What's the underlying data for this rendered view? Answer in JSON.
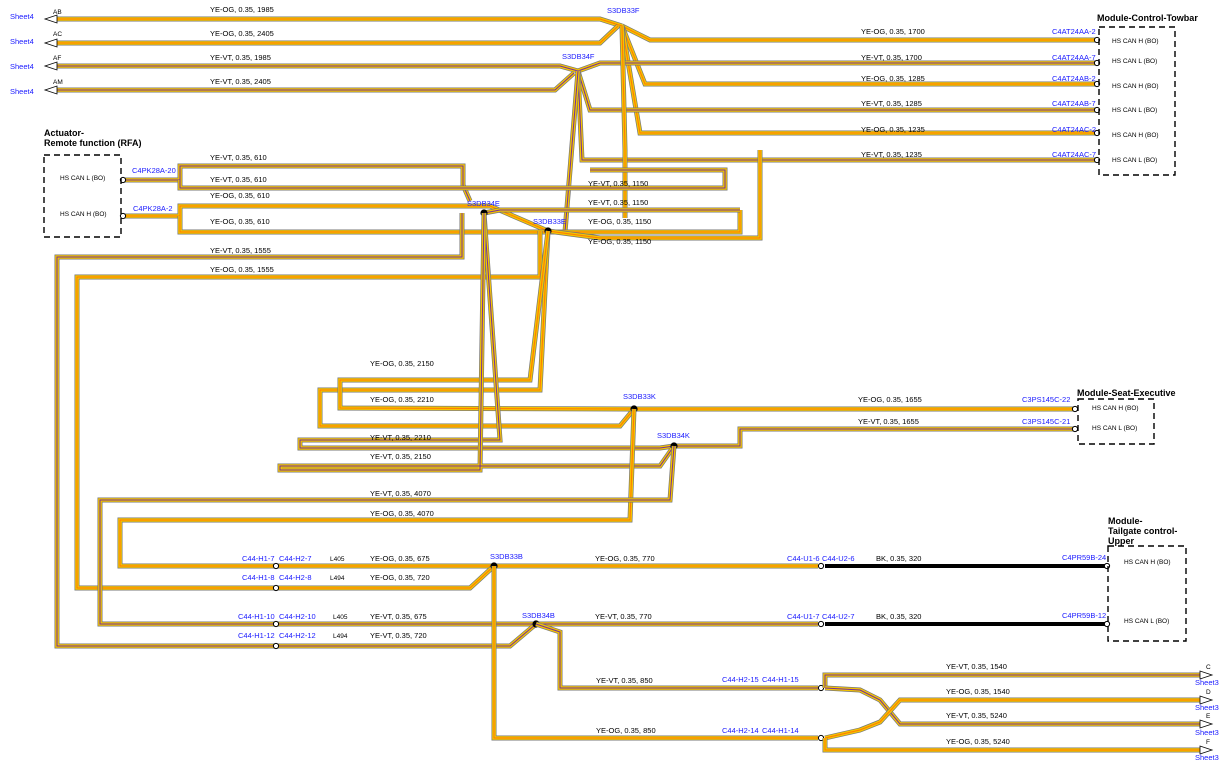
{
  "sheet_refs": [
    {
      "sheet": "Sheet4",
      "pin": "AB"
    },
    {
      "sheet": "Sheet4",
      "pin": "AC"
    },
    {
      "sheet": "Sheet4",
      "pin": "AF"
    },
    {
      "sheet": "Sheet4",
      "pin": "AM"
    },
    {
      "sheet": "Sheet3",
      "pin": "C"
    },
    {
      "sheet": "Sheet3",
      "pin": "D"
    },
    {
      "sheet": "Sheet3",
      "pin": "E"
    },
    {
      "sheet": "Sheet3",
      "pin": "F"
    }
  ],
  "modules": {
    "towbar": {
      "title": "Module-Control-Towbar",
      "pins": [
        "HS CAN H (BO)",
        "HS CAN L (BO)",
        "HS CAN H (BO)",
        "HS CAN L (BO)",
        "HS CAN H (BO)",
        "HS CAN L (BO)"
      ],
      "connectors": [
        "C4AT24AA-2",
        "C4AT24AA-7",
        "C4AT24AB-2",
        "C4AT24AB-7",
        "C4AT24AC-2",
        "C4AT24AC-7"
      ]
    },
    "actuator": {
      "title_line1": "Actuator-",
      "title_line2": "Remote function (RFA)",
      "pins": [
        "HS CAN L (BO)",
        "HS CAN H (BO)"
      ],
      "connectors": [
        "C4PK28A-20",
        "C4PK28A-2"
      ]
    },
    "seat": {
      "title": "Module-Seat-Executive",
      "pins": [
        "HS CAN H (BO)",
        "HS CAN L (BO)"
      ],
      "connectors": [
        "C3PS145C-22",
        "C3PS145C-21"
      ]
    },
    "tailgate": {
      "title_line1": "Module-",
      "title_line2": "Tailgate control-",
      "title_line3": "Upper",
      "pins": [
        "HS CAN H (BO)",
        "HS CAN L (BO)"
      ],
      "connectors": [
        "C4PR59B-24",
        "C4PR59B-12"
      ]
    }
  },
  "splices": [
    "S3DB33F",
    "S3DB34F",
    "S3DB34E",
    "S3DB33E",
    "S3DB33K",
    "S3DB34K",
    "S3DB33B",
    "S3DB34B"
  ],
  "inline_connectors": {
    "h1_7": "C44-H1-7",
    "h2_7": "C44-H2-7",
    "h1_8": "C44-H1-8",
    "h2_8": "C44-H2-8",
    "h1_10": "C44-H1-10",
    "h2_10": "C44-H2-10",
    "h1_12": "C44-H1-12",
    "h2_12": "C44-H2-12",
    "u1_6": "C44-U1-6",
    "u2_6": "C44-U2-6",
    "u1_7": "C44-U1-7",
    "u2_7": "C44-U2-7",
    "h2_15": "C44-H2-15",
    "h1_15": "C44-H1-15",
    "h2_14": "C44-H2-14",
    "h1_14": "C44-H1-14"
  },
  "circuits": {
    "l405a": "L405",
    "l494a": "L494",
    "l405b": "L405",
    "l494b": "L494"
  },
  "wire_labels": [
    "YE-OG,  0.35,  1985",
    "YE-OG,  0.35,  2405",
    "YE-VT,  0.35,  1985",
    "YE-VT,  0.35,  2405",
    "YE-OG,  0.35,  1700",
    "YE-VT,  0.35,  1700",
    "YE-OG,  0.35,  1285",
    "YE-VT,  0.35,  1285",
    "YE-OG,  0.35,  1235",
    "YE-VT,  0.35,  1235",
    "YE-VT,  0.35,  610",
    "YE-VT,  0.35,  610",
    "YE-OG,  0.35,  610",
    "YE-OG,  0.35,  610",
    "YE-VT,  0.35,  1150",
    "YE-VT,  0.35,  1150",
    "YE-OG,  0.35,  1150",
    "YE-OG,  0.35,  1150",
    "YE-VT,  0.35,  1555",
    "YE-OG,  0.35,  1555",
    "YE-OG,  0.35,  2150",
    "YE-OG,  0.35,  2210",
    "YE-VT,  0.35,  2210",
    "YE-VT,  0.35,  2150",
    "YE-OG,  0.35,  1655",
    "YE-VT,  0.35,  1655",
    "YE-VT,  0.35,  4070",
    "YE-OG,  0.35,  4070",
    "YE-OG,  0.35,  675",
    "YE-OG,  0.35,  720",
    "YE-OG,  0.35,  770",
    "BK,  0.35,  320",
    "YE-VT,  0.35,  675",
    "YE-VT,  0.35,  720",
    "YE-VT,  0.35,  770",
    "BK,  0.35,  320",
    "YE-VT,  0.35,  850",
    "YE-OG,  0.35,  850",
    "YE-VT,  0.35,  1540",
    "YE-OG,  0.35,  1540",
    "YE-VT,  0.35,  5240",
    "YE-OG,  0.35,  5240"
  ],
  "colors": {
    "yellow": "#f5c400",
    "orange": "#ff7a00",
    "violet": "#7030a0",
    "grey": "#777777",
    "black": "#000000",
    "blue": "#1a1aff"
  }
}
